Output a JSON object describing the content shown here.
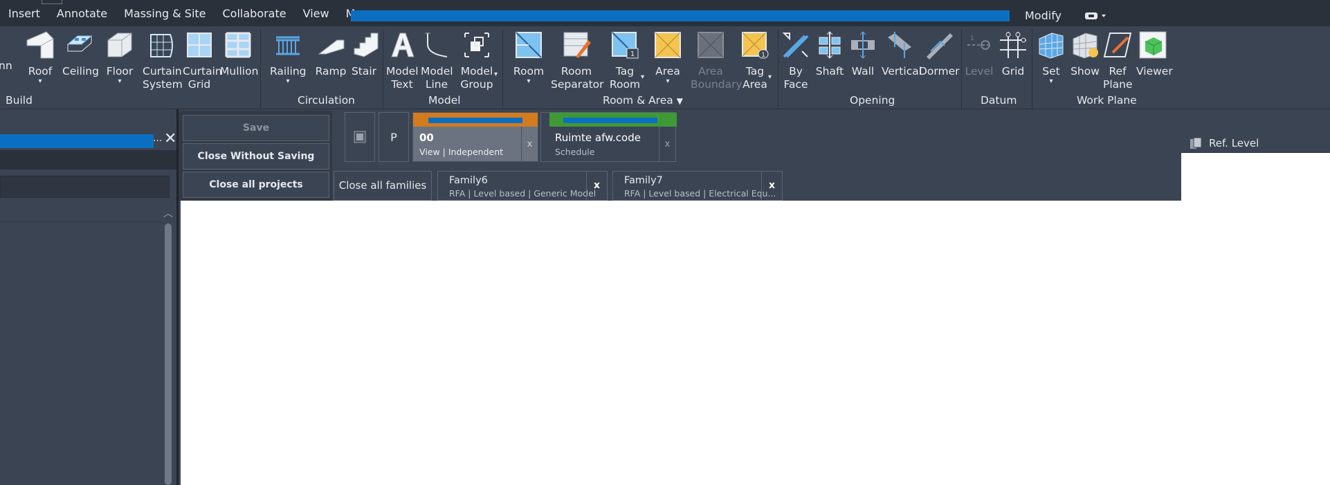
{
  "menu": {
    "items": [
      "Insert",
      "Annotate",
      "Massing & Site",
      "Collaborate",
      "View",
      "Manage"
    ],
    "modify_label": "Modify"
  },
  "ribbon": {
    "build": {
      "label": "Build",
      "partial_tool": "nn",
      "tools": [
        "Roof",
        "Ceiling",
        "Floor",
        "Curtain System",
        "Curtain Grid",
        "Mullion"
      ]
    },
    "circulation": {
      "label": "Circulation",
      "tools": [
        "Railing",
        "Ramp",
        "Stair"
      ]
    },
    "model": {
      "label": "Model",
      "tools": [
        "Model Text",
        "Model Line",
        "Model Group"
      ]
    },
    "room_area": {
      "label": "Room & Area",
      "tools": [
        "Room",
        "Room Separator",
        "Tag Room",
        "Area",
        "Area Boundary",
        "Tag Area"
      ]
    },
    "opening": {
      "label": "Opening",
      "tools": [
        "By Face",
        "Shaft",
        "Wall",
        "Vertical",
        "Dormer"
      ]
    },
    "datum": {
      "label": "Datum",
      "tools": [
        "Level",
        "Grid"
      ]
    },
    "work_plane": {
      "label": "Work Plane",
      "tools": [
        "Set",
        "Show",
        "Ref Plane",
        "Viewer"
      ]
    }
  },
  "left_panel": {
    "ellipsis": "...",
    "close_glyph": "✕"
  },
  "tabs": {
    "save_label": "Save",
    "close_without_saving_label": "Close Without Saving",
    "close_all_projects_label": "Close all projects",
    "close_all_families_label": "Close all families",
    "p_button_label": "P",
    "doc_tabs": [
      {
        "name": "00",
        "sub": "View | Independent",
        "color": "#d37b1f"
      },
      {
        "name": "Ruimte afw.code",
        "sub": "Schedule",
        "color": "#3f9a36"
      }
    ],
    "family_tabs": [
      {
        "name": "Family6",
        "sub": "RFA | Level based | Generic Model"
      },
      {
        "name": "Family7",
        "sub": "RFA | Level based | Electrical Equ..."
      }
    ],
    "close_glyph": "x"
  },
  "properties": {
    "ref_level_label": "Ref. Level"
  },
  "colors": {
    "accent_blue": "#0b6fc1",
    "ribbon_bg": "#3b4453",
    "menubar_bg": "#2b313b"
  }
}
